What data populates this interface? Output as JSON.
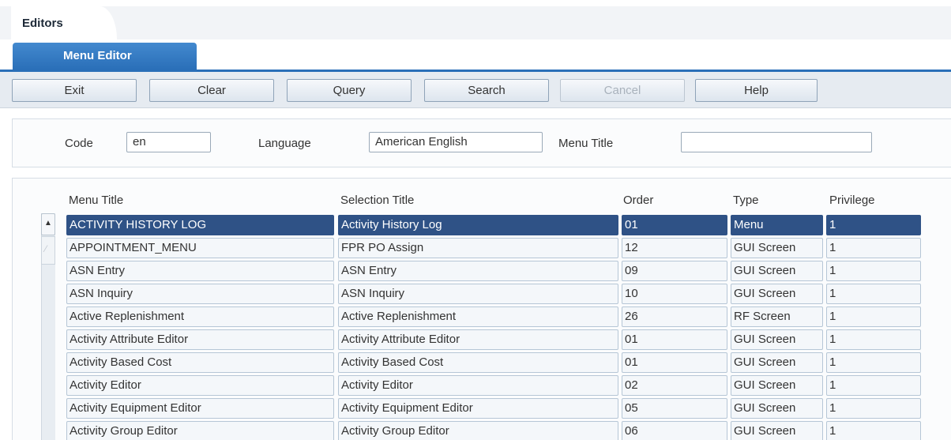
{
  "tabs": {
    "editors": "Editors",
    "menu_editor": "Menu Editor"
  },
  "toolbar": {
    "exit": "Exit",
    "clear": "Clear",
    "query": "Query",
    "search": "Search",
    "cancel": "Cancel",
    "help": "Help"
  },
  "filter": {
    "code_label": "Code",
    "code_value": "en",
    "language_label": "Language",
    "language_value": "American English",
    "menu_title_label": "Menu Title",
    "menu_title_value": ""
  },
  "table": {
    "headers": {
      "menu_title": "Menu Title",
      "selection_title": "Selection Title",
      "order": "Order",
      "type": "Type",
      "privilege": "Privilege"
    },
    "rows": [
      {
        "menu_title": "ACTIVITY HISTORY LOG",
        "selection_title": "Activity History Log",
        "order": "01",
        "type": "Menu",
        "privilege": "1"
      },
      {
        "menu_title": "APPOINTMENT_MENU",
        "selection_title": "FPR PO Assign",
        "order": "12",
        "type": "GUI Screen",
        "privilege": "1"
      },
      {
        "menu_title": "ASN Entry",
        "selection_title": "ASN Entry",
        "order": "09",
        "type": "GUI Screen",
        "privilege": "1"
      },
      {
        "menu_title": "ASN Inquiry",
        "selection_title": "ASN Inquiry",
        "order": "10",
        "type": "GUI Screen",
        "privilege": "1"
      },
      {
        "menu_title": "Active Replenishment",
        "selection_title": "Active Replenishment",
        "order": "26",
        "type": "RF Screen",
        "privilege": "1"
      },
      {
        "menu_title": "Activity Attribute Editor",
        "selection_title": "Activity Attribute Editor",
        "order": "01",
        "type": "GUI Screen",
        "privilege": "1"
      },
      {
        "menu_title": "Activity Based Cost",
        "selection_title": "Activity Based Cost",
        "order": "01",
        "type": "GUI Screen",
        "privilege": "1"
      },
      {
        "menu_title": "Activity Editor",
        "selection_title": "Activity Editor",
        "order": "02",
        "type": "GUI Screen",
        "privilege": "1"
      },
      {
        "menu_title": "Activity Equipment Editor",
        "selection_title": "Activity Equipment Editor",
        "order": "05",
        "type": "GUI Screen",
        "privilege": "1"
      },
      {
        "menu_title": "Activity Group Editor",
        "selection_title": "Activity Group Editor",
        "order": "06",
        "type": "GUI Screen",
        "privilege": "1"
      }
    ],
    "selected_row": 0
  },
  "icons": {
    "scroll_up": "scroll-up-arrow-icon"
  },
  "colors": {
    "accent": "#2a6fb8",
    "selected_row": "#2f5286"
  }
}
